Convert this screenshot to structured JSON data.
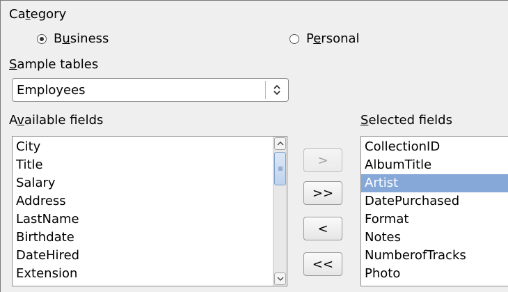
{
  "category": {
    "label_pre": "Ca",
    "label_acc": "t",
    "label_post": "egory",
    "options": [
      {
        "pre": "B",
        "acc": "u",
        "post": "siness",
        "checked": true
      },
      {
        "pre": "P",
        "acc": "e",
        "post": "rsonal",
        "checked": false
      }
    ]
  },
  "sample_tables": {
    "label_acc": "S",
    "label_post": "ample tables",
    "selected": "Employees"
  },
  "available_fields": {
    "label_pre": "A",
    "label_acc": "v",
    "label_post": "ailable fields",
    "items": [
      "City",
      "Title",
      "Salary",
      "Address",
      "LastName",
      "Birthdate",
      "DateHired",
      "Extension"
    ]
  },
  "selected_fields": {
    "label_acc": "S",
    "label_post": "elected fields",
    "items": [
      "CollectionID",
      "AlbumTitle",
      "Artist",
      "DatePurchased",
      "Format",
      "Notes",
      "NumberofTracks",
      "Photo"
    ],
    "highlighted": "Artist"
  },
  "move_buttons": {
    "add_one": ">",
    "add_all": ">>",
    "remove_one": "<",
    "remove_all": "<<"
  }
}
